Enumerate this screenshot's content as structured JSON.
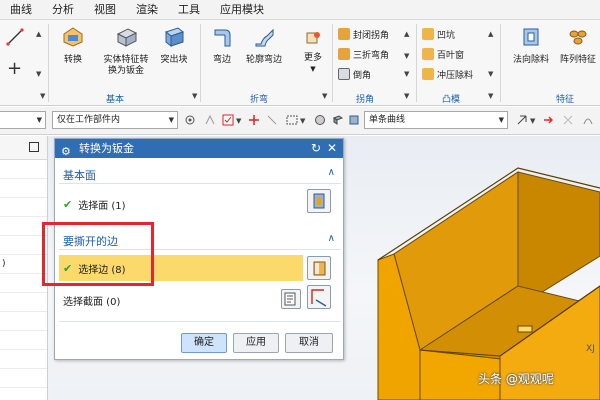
{
  "menu": {
    "items": [
      "曲线",
      "分析",
      "视图",
      "渲染",
      "工具",
      "应用模块"
    ]
  },
  "ribbon": {
    "convert_label": "转换",
    "solid_to_sheet_label": "实体特征转换为钣金",
    "solid_to_sheet_line2": "换为钣金",
    "solid_to_sheet_line1": "实体特征转",
    "tab_label": "突出块",
    "basic_group": "基本",
    "bend_label": "弯边",
    "contour_bend_label": "轮廓弯边",
    "more_label": "更多",
    "bend_group": "折弯",
    "closed_corner": "封闭拐角",
    "three_bend_corner": "三折弯角",
    "chamfer": "倒角",
    "corner_group": "拐角",
    "dimple": "凹坑",
    "louver": "百叶窗",
    "drawn_cutout": "冲压除料",
    "convex_group": "凸模",
    "normal_cutout": "法向除料",
    "array_feature": "阵列特征",
    "feature_group": "特征"
  },
  "toolbar2": {
    "filter_scope": "仅在工作部件内",
    "curve_rule": "单条曲线"
  },
  "dialog": {
    "title": "转换为钣金",
    "section_basic": "基本面",
    "select_face": "选择面 (1)",
    "section_rip": "要撕开的边",
    "select_edge": "选择边 (8)",
    "select_section": "选择截面 (0)",
    "ok": "确定",
    "apply": "应用",
    "cancel": "取消"
  },
  "navigator": {
    "partial_text": ")"
  },
  "graphics": {
    "axis_label": "XJ",
    "watermark": "头条 @观观呢"
  },
  "colors": {
    "title_bar": "#2f6db5",
    "selection_highlight": "#fbd96a",
    "model_face": "#f0a400",
    "callout_border": "#e8242c",
    "accent_text": "#1a5fb4"
  }
}
